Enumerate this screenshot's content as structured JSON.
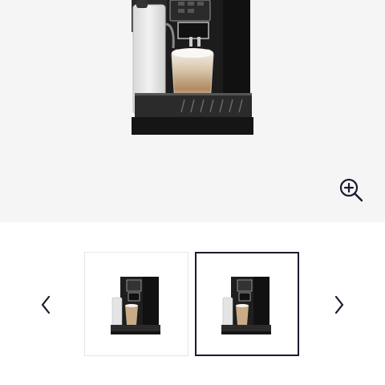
{
  "gallery": {
    "main_image": {
      "icon": "coffee-machine-image"
    },
    "zoom": {
      "icon": "zoom-in-icon"
    },
    "prev": {
      "icon": "chevron-left-icon"
    },
    "next": {
      "icon": "chevron-right-icon"
    },
    "thumbnails": [
      {
        "icon": "coffee-machine-thumbnail",
        "selected": false
      },
      {
        "icon": "coffee-machine-thumbnail",
        "selected": true
      }
    ]
  },
  "colors": {
    "hero_background": "#f5f5f5",
    "selected_border": "#1a1a2e",
    "thumbnail_border": "#e6e6e6",
    "icon": "#1a1a2e"
  }
}
